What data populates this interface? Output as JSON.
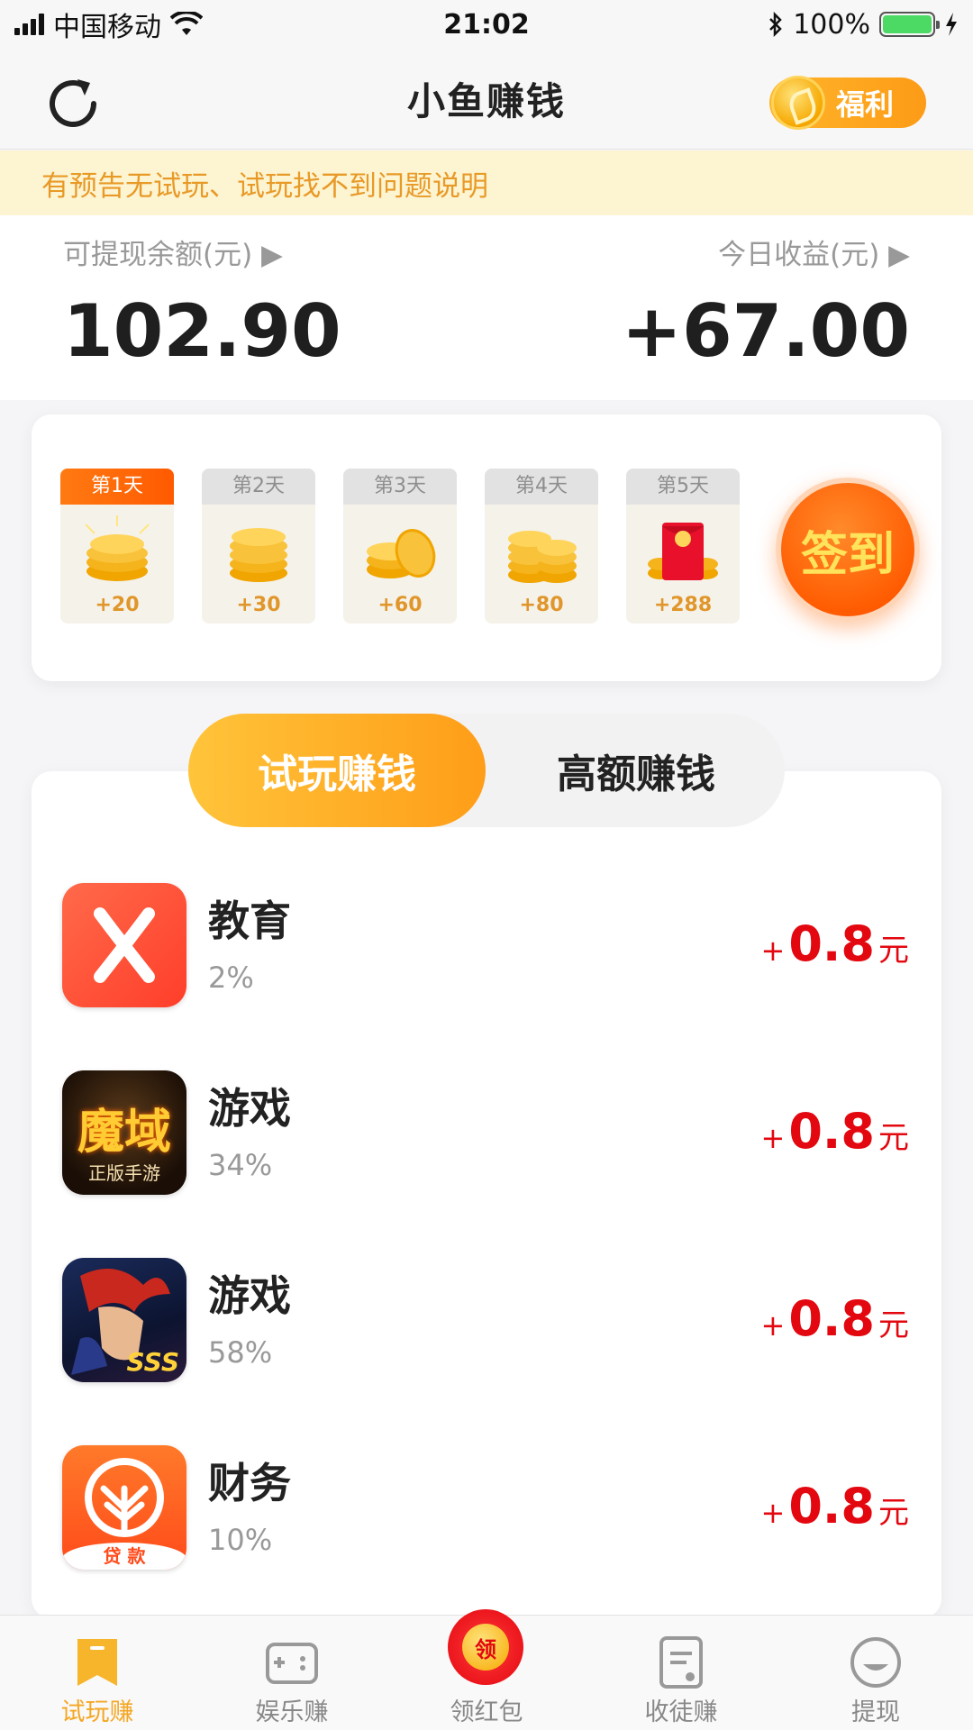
{
  "status_bar": {
    "carrier": "中国移动",
    "time": "21:02",
    "battery": "100%"
  },
  "nav": {
    "title": "小鱼赚钱",
    "welfare_label": "福利"
  },
  "notice": {
    "text": "有预告无试玩、试玩找不到问题说明"
  },
  "balance": {
    "withdrawable_label": "可提现余额(元) ▶",
    "withdrawable_value": "102.90",
    "today_label": "今日收益(元) ▶",
    "today_value": "+67.00"
  },
  "checkin": {
    "days": [
      {
        "label": "第1天",
        "reward": "+20",
        "active": true
      },
      {
        "label": "第2天",
        "reward": "+30",
        "active": false
      },
      {
        "label": "第3天",
        "reward": "+60",
        "active": false
      },
      {
        "label": "第4天",
        "reward": "+80",
        "active": false
      },
      {
        "label": "第5天",
        "reward": "+288",
        "active": false
      }
    ],
    "button_label": "签到"
  },
  "tabs": {
    "active": "试玩赚钱",
    "inactive": "高额赚钱"
  },
  "tasks": [
    {
      "category": "教育",
      "percent": "2%",
      "plus": "+",
      "amount": "0.8",
      "unit": "元",
      "icon": "education-app-icon"
    },
    {
      "category": "游戏",
      "percent": "34%",
      "plus": "+",
      "amount": "0.8",
      "unit": "元",
      "icon": "moyu-game-icon",
      "icon_text": "魔域",
      "icon_sub": "正版手游"
    },
    {
      "category": "游戏",
      "percent": "58%",
      "plus": "+",
      "amount": "0.8",
      "unit": "元",
      "icon": "hero-game-icon",
      "icon_text": "SSS"
    },
    {
      "category": "财务",
      "percent": "10%",
      "plus": "+",
      "amount": "0.8",
      "unit": "元",
      "icon": "loan-app-icon",
      "icon_text": "贷 款"
    }
  ],
  "bottom_tabs": [
    {
      "label": "试玩赚",
      "active": true
    },
    {
      "label": "娱乐赚",
      "active": false
    },
    {
      "label": "领红包",
      "active": false,
      "badge": "领"
    },
    {
      "label": "收徒赚",
      "active": false
    },
    {
      "label": "提现",
      "active": false
    }
  ],
  "colors": {
    "accent": "#f5a623",
    "reward_red": "#e3070f",
    "notice_text": "#e89a27"
  }
}
